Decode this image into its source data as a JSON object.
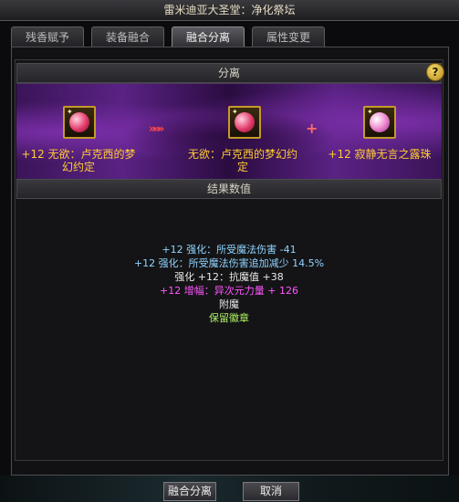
{
  "window": {
    "title": "雷米迪亚大圣堂：净化祭坛"
  },
  "tabs": [
    {
      "label": "残香赋予",
      "active": false
    },
    {
      "label": "装备融合",
      "active": false
    },
    {
      "label": "融合分离",
      "active": true
    },
    {
      "label": "属性变更",
      "active": false
    }
  ],
  "separation": {
    "header": "分离",
    "help_icon": "?",
    "source_item": {
      "label": "+12 无欲：卢克西的梦幻约定",
      "icon": "pink-orb-icon"
    },
    "arrow_icon": "»»»",
    "result_item": {
      "label": "无欲：卢克西的梦幻约定",
      "icon": "pink-orb-icon"
    },
    "plus_icon": "+",
    "extra_item": {
      "label": "+12 寂静无言之露珠",
      "icon": "dewdrop-icon"
    }
  },
  "results": {
    "header": "结果数值",
    "lines": [
      "+12 强化：所受魔法伤害 -41",
      "+12 强化：所受魔法伤害追加减少 14.5%",
      "强化 +12：抗魔值 +38",
      "+12 增幅：异次元力量 + 126",
      "附魔",
      "保留徽章"
    ]
  },
  "buttons": {
    "confirm": "融合分离",
    "cancel": "取消"
  },
  "colors": {
    "item_name": "#ffcc33",
    "stat_blue": "#8fd3ff",
    "stat_white": "#e8e8e8",
    "stat_magenta": "#ff55ff",
    "stat_green": "#aef064"
  }
}
